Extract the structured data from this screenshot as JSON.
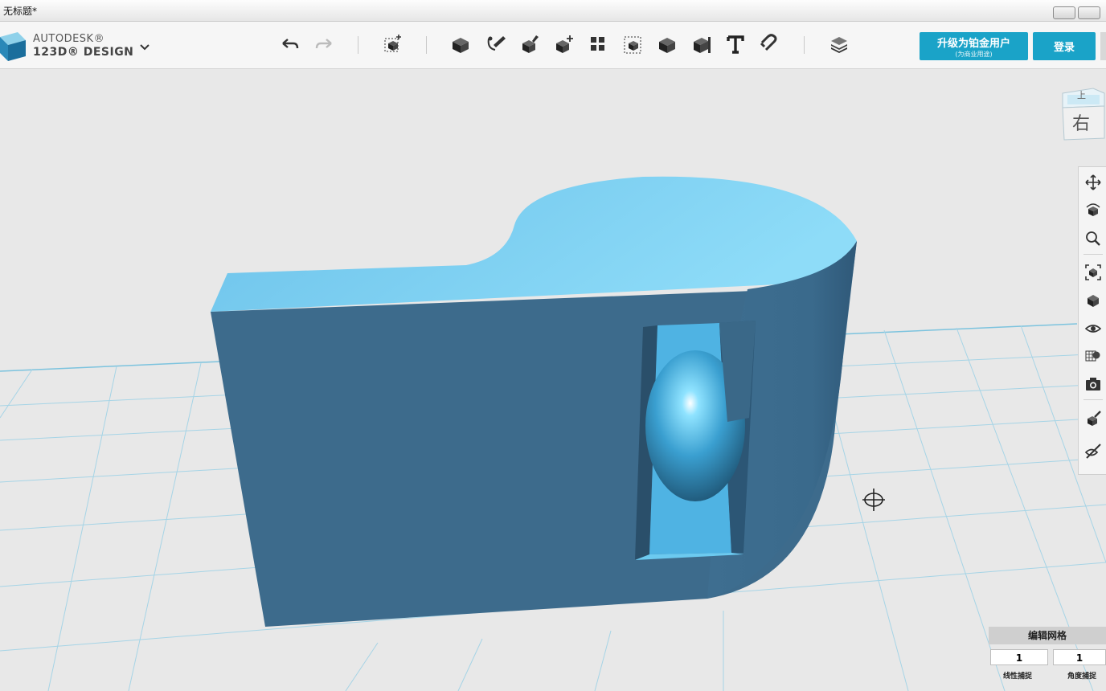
{
  "window": {
    "title": "无标题*"
  },
  "brand": {
    "line1": "AUTODESK®",
    "line2": "123D® DESIGN"
  },
  "toolbar": {
    "tools": [
      "undo-icon",
      "redo-icon",
      "primitives-icon",
      "sketch-icon",
      "construct-icon",
      "modify-icon",
      "pattern-icon",
      "grouping-icon",
      "combine-icon",
      "measure-icon",
      "text-icon",
      "snap-icon",
      "layers-icon"
    ]
  },
  "cta": {
    "upgrade_label": "升级为铂金用户",
    "upgrade_sub": "(为商业用途)",
    "login_label": "登录"
  },
  "viewcube": {
    "top_label": "上",
    "front_label": "右"
  },
  "navbar": {
    "tools": [
      "pan-icon",
      "orbit-icon",
      "zoom-icon",
      "fit-icon",
      "view-mode-icon",
      "visibility-icon",
      "material-icon",
      "camera-icon",
      "materials-brush-icon",
      "hide-icon"
    ]
  },
  "snap_panel": {
    "title": "编辑网格",
    "linear_value": "1",
    "linear_label": "线性捕捉",
    "angle_value": "1",
    "angle_label": "角度捕捉"
  },
  "colors": {
    "accent": "#1aa3c8",
    "model_top": "#6fc7ee",
    "model_front": "#3d6b8c",
    "grid_line": "#9fd2e6"
  }
}
